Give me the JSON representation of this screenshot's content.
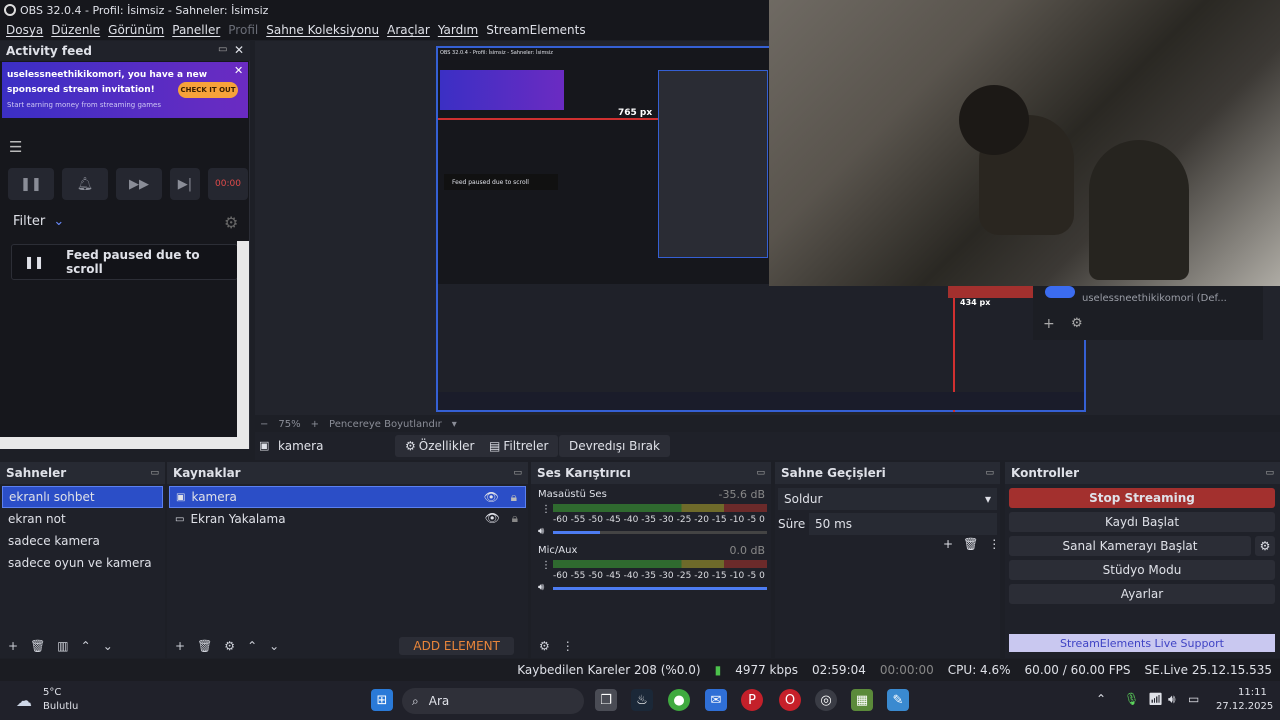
{
  "window": {
    "title": "OBS 32.0.4 - Profil: İsimsiz - Sahneler: İsimsiz"
  },
  "menu": [
    "Dosya",
    "Düzenle",
    "Görünüm",
    "Paneller",
    "Profil",
    "Sahne Koleksiyonu",
    "Araçlar",
    "Yardım",
    "StreamElements"
  ],
  "activity_feed": {
    "title": "Activity feed",
    "banner_line1": "uselessneethikikomori, you have a new",
    "banner_line2": "sponsored stream invitation!",
    "banner_sub": "Start earning money from streaming games",
    "banner_button": "CHECK IT OUT",
    "time": "00:00",
    "filter_label": "Filter",
    "paused_text": "Feed paused due to scroll"
  },
  "preview": {
    "zoom": "75%",
    "resize_label": "Pencereye Boyutlandır",
    "px_label_1": "765 px",
    "px_label_2": "434 px",
    "cam_account": "uselessneethikikomori (Def..."
  },
  "source_bar": {
    "selected_source": "kamera",
    "props": "Özellikler",
    "filters": "Filtreler",
    "deactivate": "Devredışı Bırak"
  },
  "scenes": {
    "title": "Sahneler",
    "items": [
      "ekranlı sohbet",
      "ekran not",
      "sadece kamera",
      "sadece oyun ve kamera"
    ]
  },
  "sources": {
    "title": "Kaynaklar",
    "items": [
      "kamera",
      "Ekran Yakalama"
    ],
    "add_element": "ADD ELEMENT"
  },
  "mixer": {
    "title": "Ses Karıştırıcı",
    "channels": [
      {
        "name": "Masaüstü Ses",
        "db": "-35.6 dB",
        "level": 0.22
      },
      {
        "name": "Mic/Aux",
        "db": "0.0 dB",
        "level": 0.7
      }
    ],
    "ticks": [
      "-60",
      "-55",
      "-50",
      "-45",
      "-40",
      "-35",
      "-30",
      "-25",
      "-20",
      "-15",
      "-10",
      "-5",
      "0"
    ]
  },
  "transitions": {
    "title": "Sahne Geçişleri",
    "type": "Soldur",
    "duration_label": "Süre",
    "duration": "50 ms"
  },
  "controls": {
    "title": "Kontroller",
    "stop": "Stop Streaming",
    "record": "Kaydı Başlat",
    "vcam": "Sanal Kamerayı Başlat",
    "studio": "Stüdyo Modu",
    "settings": "Ayarlar",
    "support": "StreamElements Live Support"
  },
  "status": {
    "dropped": "Kaybedilen Kareler 208 (%0.0)",
    "bitrate": "4977 kbps",
    "stream_time": "02:59:04",
    "rec_time": "00:00:00",
    "cpu": "CPU: 4.6%",
    "fps": "60.00 / 60.00 FPS",
    "version": "SE.Live 25.12.15.535"
  },
  "taskbar": {
    "temp": "5°C",
    "weather": "Bulutlu",
    "search": "Ara",
    "time": "11:11",
    "date": "27.12.2025"
  },
  "colors": {
    "accent": "#2b4ec7",
    "stop": "#a3302e",
    "support": "#c9c8f0"
  }
}
